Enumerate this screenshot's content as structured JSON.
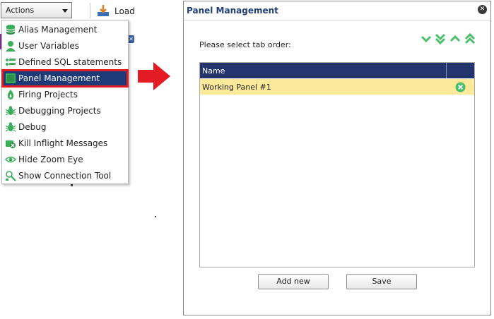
{
  "toolbar": {
    "actions_label": "Actions",
    "load_label": "Load"
  },
  "menu": {
    "items": [
      {
        "label": "Alias Management",
        "icon": "database-stack-icon"
      },
      {
        "label": "User Variables",
        "icon": "user-icon"
      },
      {
        "label": "Defined SQL statements",
        "icon": "sql-list-icon"
      },
      {
        "label": "Panel Management",
        "icon": "panel-icon",
        "selected": true
      },
      {
        "label": "Firing Projects",
        "icon": "flame-icon"
      },
      {
        "label": "Debugging Projects",
        "icon": "bug-icon"
      },
      {
        "label": "Debug",
        "icon": "bug-icon"
      },
      {
        "label": "Kill Inflight Messages",
        "icon": "kill-messages-icon"
      },
      {
        "label": "Hide Zoom Eye",
        "icon": "eye-icon"
      },
      {
        "label": "Show Connection Tool",
        "icon": "connection-tool-icon"
      }
    ]
  },
  "panel": {
    "title": "Panel Management",
    "order_label": "Please select tab order:",
    "table": {
      "columns": [
        "Name",
        ""
      ],
      "rows": [
        {
          "name": "Working Panel #1",
          "selected": true
        }
      ]
    },
    "buttons": {
      "add_new": "Add new",
      "save": "Save"
    }
  },
  "colors": {
    "accent_green": "#4cbf6a",
    "header_blue": "#23346e",
    "highlight_red": "#e31b23",
    "row_selected": "#fde99a",
    "title_blue": "#1f3d78"
  }
}
